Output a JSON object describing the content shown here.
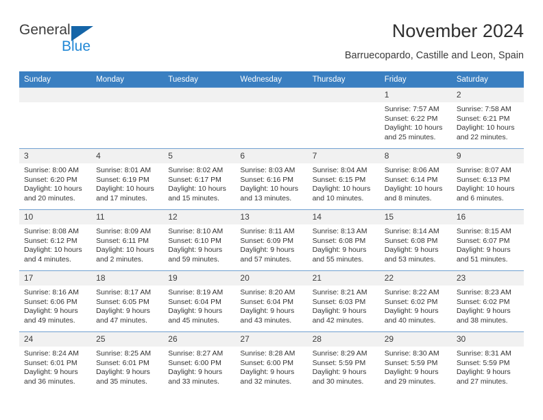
{
  "brand": {
    "name_part1": "General",
    "name_part2": "Blue",
    "triangle_color": "#1565a8",
    "blue_color": "#2288d6"
  },
  "header": {
    "title": "November 2024",
    "location": "Barruecopardo, Castille and Leon, Spain"
  },
  "theme": {
    "header_bg": "#3a7fc1",
    "header_text": "#ffffff",
    "daynum_bg": "#f1f1f1",
    "row_rule": "#6f9fd0"
  },
  "weekday_headers": [
    "Sunday",
    "Monday",
    "Tuesday",
    "Wednesday",
    "Thursday",
    "Friday",
    "Saturday"
  ],
  "labels": {
    "sunrise_prefix": "Sunrise:",
    "sunset_prefix": "Sunset:",
    "daylight_prefix": "Daylight:"
  },
  "weeks": [
    [
      {
        "day": "",
        "empty": true
      },
      {
        "day": "",
        "empty": true
      },
      {
        "day": "",
        "empty": true
      },
      {
        "day": "",
        "empty": true
      },
      {
        "day": "",
        "empty": true
      },
      {
        "day": "1",
        "sunrise": "Sunrise: 7:57 AM",
        "sunset": "Sunset: 6:22 PM",
        "daylight1": "Daylight: 10 hours",
        "daylight2": "and 25 minutes."
      },
      {
        "day": "2",
        "sunrise": "Sunrise: 7:58 AM",
        "sunset": "Sunset: 6:21 PM",
        "daylight1": "Daylight: 10 hours",
        "daylight2": "and 22 minutes."
      }
    ],
    [
      {
        "day": "3",
        "sunrise": "Sunrise: 8:00 AM",
        "sunset": "Sunset: 6:20 PM",
        "daylight1": "Daylight: 10 hours",
        "daylight2": "and 20 minutes."
      },
      {
        "day": "4",
        "sunrise": "Sunrise: 8:01 AM",
        "sunset": "Sunset: 6:19 PM",
        "daylight1": "Daylight: 10 hours",
        "daylight2": "and 17 minutes."
      },
      {
        "day": "5",
        "sunrise": "Sunrise: 8:02 AM",
        "sunset": "Sunset: 6:17 PM",
        "daylight1": "Daylight: 10 hours",
        "daylight2": "and 15 minutes."
      },
      {
        "day": "6",
        "sunrise": "Sunrise: 8:03 AM",
        "sunset": "Sunset: 6:16 PM",
        "daylight1": "Daylight: 10 hours",
        "daylight2": "and 13 minutes."
      },
      {
        "day": "7",
        "sunrise": "Sunrise: 8:04 AM",
        "sunset": "Sunset: 6:15 PM",
        "daylight1": "Daylight: 10 hours",
        "daylight2": "and 10 minutes."
      },
      {
        "day": "8",
        "sunrise": "Sunrise: 8:06 AM",
        "sunset": "Sunset: 6:14 PM",
        "daylight1": "Daylight: 10 hours",
        "daylight2": "and 8 minutes."
      },
      {
        "day": "9",
        "sunrise": "Sunrise: 8:07 AM",
        "sunset": "Sunset: 6:13 PM",
        "daylight1": "Daylight: 10 hours",
        "daylight2": "and 6 minutes."
      }
    ],
    [
      {
        "day": "10",
        "sunrise": "Sunrise: 8:08 AM",
        "sunset": "Sunset: 6:12 PM",
        "daylight1": "Daylight: 10 hours",
        "daylight2": "and 4 minutes."
      },
      {
        "day": "11",
        "sunrise": "Sunrise: 8:09 AM",
        "sunset": "Sunset: 6:11 PM",
        "daylight1": "Daylight: 10 hours",
        "daylight2": "and 2 minutes."
      },
      {
        "day": "12",
        "sunrise": "Sunrise: 8:10 AM",
        "sunset": "Sunset: 6:10 PM",
        "daylight1": "Daylight: 9 hours",
        "daylight2": "and 59 minutes."
      },
      {
        "day": "13",
        "sunrise": "Sunrise: 8:11 AM",
        "sunset": "Sunset: 6:09 PM",
        "daylight1": "Daylight: 9 hours",
        "daylight2": "and 57 minutes."
      },
      {
        "day": "14",
        "sunrise": "Sunrise: 8:13 AM",
        "sunset": "Sunset: 6:08 PM",
        "daylight1": "Daylight: 9 hours",
        "daylight2": "and 55 minutes."
      },
      {
        "day": "15",
        "sunrise": "Sunrise: 8:14 AM",
        "sunset": "Sunset: 6:08 PM",
        "daylight1": "Daylight: 9 hours",
        "daylight2": "and 53 minutes."
      },
      {
        "day": "16",
        "sunrise": "Sunrise: 8:15 AM",
        "sunset": "Sunset: 6:07 PM",
        "daylight1": "Daylight: 9 hours",
        "daylight2": "and 51 minutes."
      }
    ],
    [
      {
        "day": "17",
        "sunrise": "Sunrise: 8:16 AM",
        "sunset": "Sunset: 6:06 PM",
        "daylight1": "Daylight: 9 hours",
        "daylight2": "and 49 minutes."
      },
      {
        "day": "18",
        "sunrise": "Sunrise: 8:17 AM",
        "sunset": "Sunset: 6:05 PM",
        "daylight1": "Daylight: 9 hours",
        "daylight2": "and 47 minutes."
      },
      {
        "day": "19",
        "sunrise": "Sunrise: 8:19 AM",
        "sunset": "Sunset: 6:04 PM",
        "daylight1": "Daylight: 9 hours",
        "daylight2": "and 45 minutes."
      },
      {
        "day": "20",
        "sunrise": "Sunrise: 8:20 AM",
        "sunset": "Sunset: 6:04 PM",
        "daylight1": "Daylight: 9 hours",
        "daylight2": "and 43 minutes."
      },
      {
        "day": "21",
        "sunrise": "Sunrise: 8:21 AM",
        "sunset": "Sunset: 6:03 PM",
        "daylight1": "Daylight: 9 hours",
        "daylight2": "and 42 minutes."
      },
      {
        "day": "22",
        "sunrise": "Sunrise: 8:22 AM",
        "sunset": "Sunset: 6:02 PM",
        "daylight1": "Daylight: 9 hours",
        "daylight2": "and 40 minutes."
      },
      {
        "day": "23",
        "sunrise": "Sunrise: 8:23 AM",
        "sunset": "Sunset: 6:02 PM",
        "daylight1": "Daylight: 9 hours",
        "daylight2": "and 38 minutes."
      }
    ],
    [
      {
        "day": "24",
        "sunrise": "Sunrise: 8:24 AM",
        "sunset": "Sunset: 6:01 PM",
        "daylight1": "Daylight: 9 hours",
        "daylight2": "and 36 minutes."
      },
      {
        "day": "25",
        "sunrise": "Sunrise: 8:25 AM",
        "sunset": "Sunset: 6:01 PM",
        "daylight1": "Daylight: 9 hours",
        "daylight2": "and 35 minutes."
      },
      {
        "day": "26",
        "sunrise": "Sunrise: 8:27 AM",
        "sunset": "Sunset: 6:00 PM",
        "daylight1": "Daylight: 9 hours",
        "daylight2": "and 33 minutes."
      },
      {
        "day": "27",
        "sunrise": "Sunrise: 8:28 AM",
        "sunset": "Sunset: 6:00 PM",
        "daylight1": "Daylight: 9 hours",
        "daylight2": "and 32 minutes."
      },
      {
        "day": "28",
        "sunrise": "Sunrise: 8:29 AM",
        "sunset": "Sunset: 5:59 PM",
        "daylight1": "Daylight: 9 hours",
        "daylight2": "and 30 minutes."
      },
      {
        "day": "29",
        "sunrise": "Sunrise: 8:30 AM",
        "sunset": "Sunset: 5:59 PM",
        "daylight1": "Daylight: 9 hours",
        "daylight2": "and 29 minutes."
      },
      {
        "day": "30",
        "sunrise": "Sunrise: 8:31 AM",
        "sunset": "Sunset: 5:59 PM",
        "daylight1": "Daylight: 9 hours",
        "daylight2": "and 27 minutes."
      }
    ]
  ]
}
